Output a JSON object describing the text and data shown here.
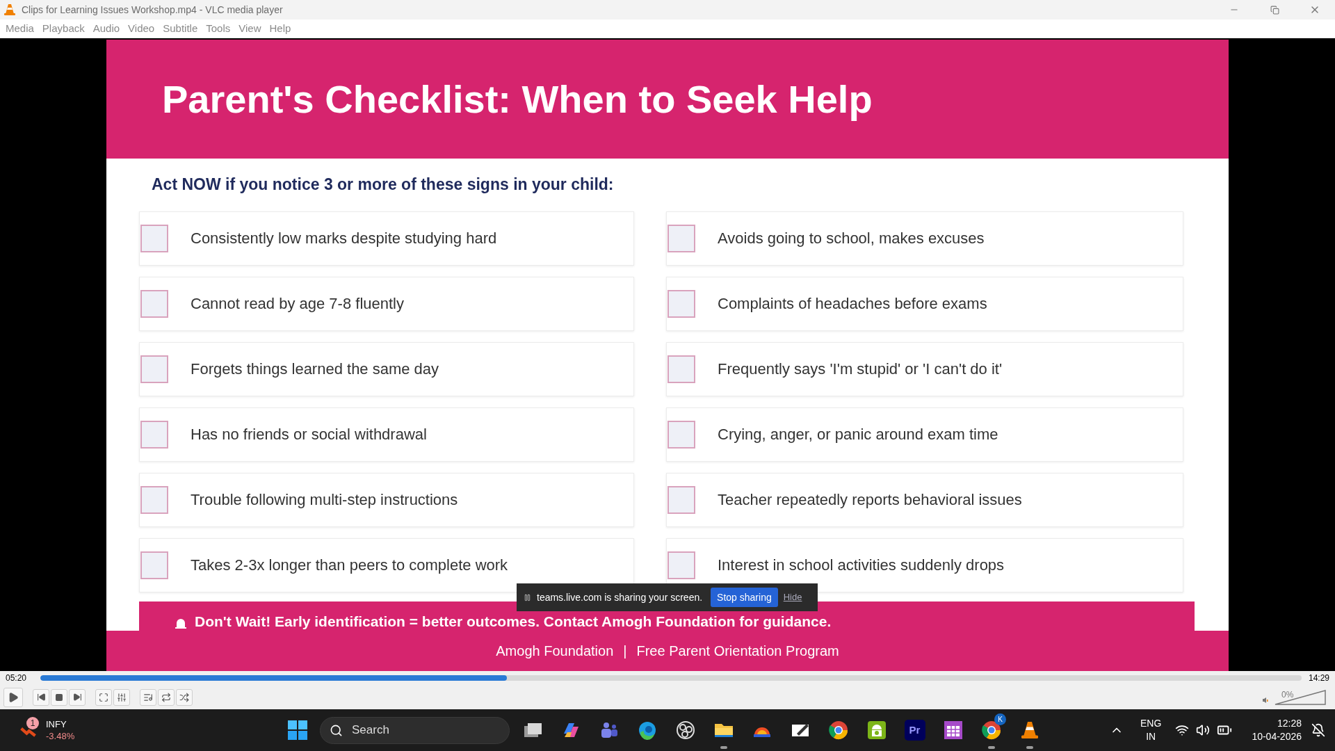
{
  "window": {
    "title": "Clips for Learning Issues Workshop.mp4 - VLC media player"
  },
  "menu": [
    "Media",
    "Playback",
    "Audio",
    "Video",
    "Subtitle",
    "Tools",
    "View",
    "Help"
  ],
  "slide": {
    "title": "Parent's Checklist: When to Seek Help",
    "subtitle": "Act NOW if you notice 3 or more of these signs in your child:",
    "left_items": [
      {
        "text": "Consistently low marks despite studying hard",
        "checked": false
      },
      {
        "text": "Cannot read by age 7-8 fluently",
        "checked": false
      },
      {
        "text": "Forgets things learned the same day",
        "checked": false
      },
      {
        "text": "Has no friends or social withdrawal",
        "checked": false
      },
      {
        "text": "Trouble following multi-step instructions",
        "checked": false
      },
      {
        "text": "Takes 2-3x longer than peers to complete work",
        "checked": false
      }
    ],
    "right_items": [
      {
        "text": "Avoids going to school, makes excuses",
        "checked": false
      },
      {
        "text": "Complaints of headaches before exams",
        "checked": false
      },
      {
        "text": "Frequently says 'I'm stupid' or 'I can't do it'",
        "checked": false
      },
      {
        "text": "Crying, anger, or panic around exam time",
        "checked": false
      },
      {
        "text": "Teacher repeatedly reports behavioral issues",
        "checked": false
      },
      {
        "text": "Interest in school activities suddenly drops",
        "checked": false
      }
    ],
    "banner": "Don't Wait! Early identification = better outcomes. Contact Amogh Foundation for guidance.",
    "footer": [
      "Amogh Foundation",
      "|",
      "Free Parent Orientation Program"
    ]
  },
  "share_bar": {
    "message": "teams.live.com is sharing your screen.",
    "stop": "Stop sharing",
    "hide": "Hide"
  },
  "player": {
    "elapsed": "05:20",
    "total": "14:29",
    "progress": {
      "level": 0.37
    },
    "volume": {
      "label": "0%",
      "level": 0
    }
  },
  "taskbar": {
    "stock": {
      "badge": "1",
      "symbol": "INFY",
      "change": "-3.48%"
    },
    "search": {
      "placeholder": "Search"
    },
    "apps": [
      {
        "kind": "taskview",
        "running": false
      },
      {
        "kind": "copilot",
        "running": false
      },
      {
        "kind": "teams",
        "running": false
      },
      {
        "kind": "edge",
        "running": false
      },
      {
        "kind": "obs",
        "running": false
      },
      {
        "kind": "explorer",
        "running": true
      },
      {
        "kind": "hat",
        "running": false
      },
      {
        "kind": "whiteboard",
        "running": false
      },
      {
        "kind": "chrome",
        "running": false
      },
      {
        "kind": "android",
        "running": false
      },
      {
        "kind": "premiere",
        "label": "Pr",
        "running": false
      },
      {
        "kind": "calendar",
        "running": false
      },
      {
        "kind": "chrome",
        "badge": "K",
        "running": true
      },
      {
        "kind": "vlc",
        "running": true
      }
    ],
    "language": [
      "ENG",
      "IN"
    ],
    "time": "12:28",
    "date": "10-04-2026"
  }
}
